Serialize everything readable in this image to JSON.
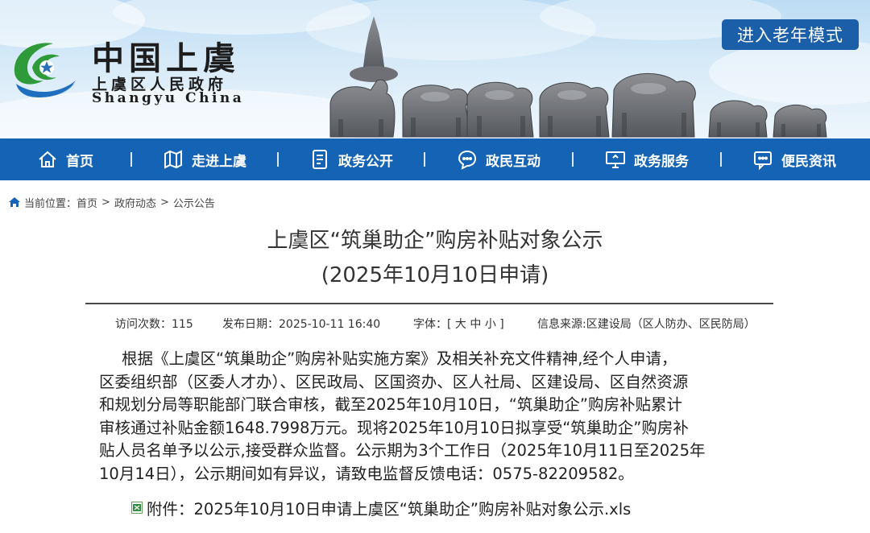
{
  "header": {
    "logo_cn": "中国上虞",
    "logo_sub": "上虞区人民政府",
    "logo_en": "Shangyu China",
    "elder_mode_label": "进入老年模式"
  },
  "nav": {
    "items": [
      {
        "label": "首页",
        "icon": "home-icon"
      },
      {
        "label": "走进上虞",
        "icon": "map-icon"
      },
      {
        "label": "政务公开",
        "icon": "document-icon"
      },
      {
        "label": "政民互动",
        "icon": "chat-icon"
      },
      {
        "label": "政务服务",
        "icon": "monitor-icon"
      },
      {
        "label": "便民资讯",
        "icon": "message-icon"
      }
    ]
  },
  "breadcrumb": {
    "prefix": "当前位置：",
    "items": [
      "首页",
      "政府动态",
      "公示公告"
    ],
    "separator": ">"
  },
  "article": {
    "title_line1": "上虞区“筑巢助企”购房补贴对象公示",
    "title_line2": "(2025年10月10日申请)",
    "meta": {
      "visits_label": "访问次数：",
      "visits": "115",
      "date_label": "发布日期：",
      "date": "2025-10-11 16:40",
      "font_label": "字体：[",
      "font_large": "大",
      "font_medium": "中",
      "font_small": "小",
      "font_close": "]",
      "source": "信息来源:区建设局（区人防办、区民防局）"
    },
    "body_lines": [
      "根据《上虞区“筑巢助企”购房补贴实施方案》及相关补充文件精神,经个人申请，",
      "区委组织部（区委人才办）、区民政局、区国资办、区人社局、区建设局、区自然资源",
      "和规划分局等职能部门联合审核，截至2025年10月10日，“筑巢助企”购房补贴累计",
      "审核通过补贴金额1648.7998万元。现将2025年10月10日拟享受“筑巢助企”购房补",
      "贴人员名单予以公示,接受群众监督。公示期为3个工作日（2025年10月11日至2025年",
      "10月14日），公示期间如有异议，请致电监督反馈电话：0575-82209582。"
    ],
    "attachment_label": "附件：",
    "attachment_file": "2025年10月10日申请上虞区“筑巢助企”购房补贴对象公示.xls"
  },
  "colors": {
    "nav_bg": "#1463b5",
    "elder_btn_bg": "#1b5fa8",
    "logo_green": "#2e9a3a",
    "logo_blue": "#1f6fbf"
  }
}
